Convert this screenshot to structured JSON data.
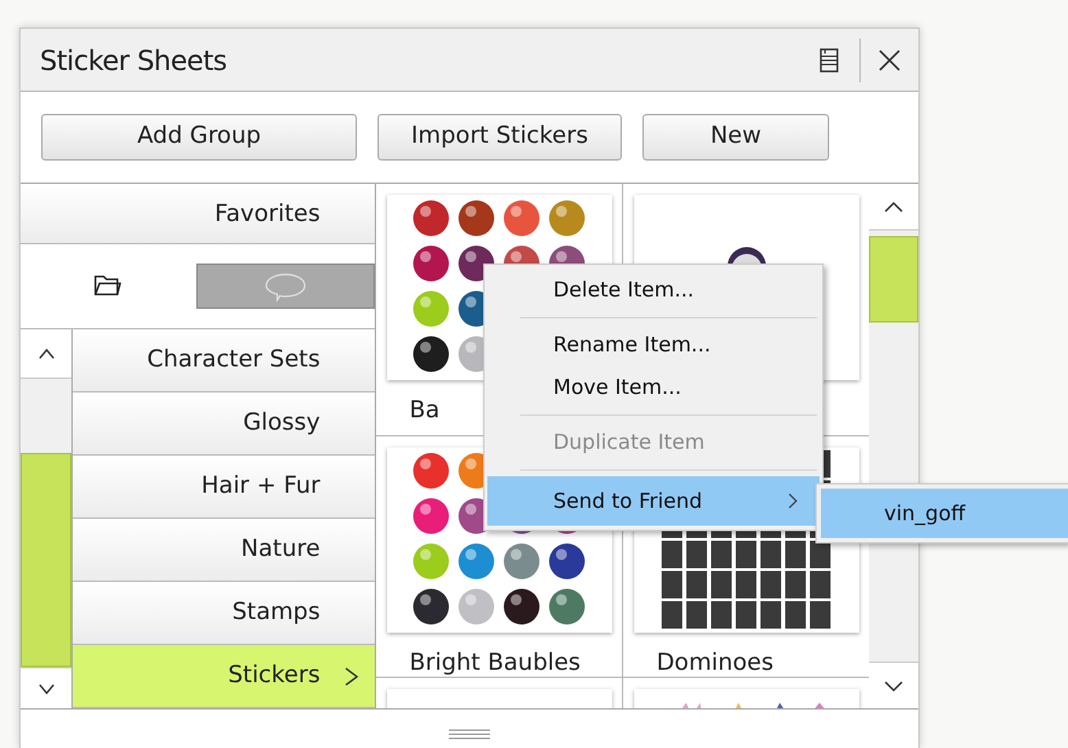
{
  "window": {
    "title": "Sticker Sheets"
  },
  "toolbar": {
    "buttons": [
      "Add Group",
      "Import Stickers",
      "New"
    ]
  },
  "sidebar": {
    "favorites": "Favorites",
    "tabs": [
      {
        "kind": "folder",
        "selected": true
      },
      {
        "kind": "chat",
        "selected": false
      }
    ],
    "groups": [
      {
        "label": "Character Sets",
        "selected": false
      },
      {
        "label": "Glossy",
        "selected": false
      },
      {
        "label": "Hair + Fur",
        "selected": false
      },
      {
        "label": "Nature",
        "selected": false
      },
      {
        "label": "Stamps",
        "selected": false
      },
      {
        "label": "Stickers",
        "selected": true
      }
    ]
  },
  "sheets": [
    {
      "kind": "baubles",
      "label": "Ba"
    },
    {
      "kind": "sphere"
    },
    {
      "kind": "baubles",
      "label": "Bright Baubles"
    },
    {
      "kind": "dominoes",
      "label": "Dominoes"
    },
    {
      "kind": "blank"
    },
    {
      "kind": "butterflies"
    }
  ],
  "context_menu": {
    "items": [
      {
        "kind": "item",
        "label": "Delete Item...",
        "disabled": false,
        "selected": false
      },
      {
        "kind": "separator"
      },
      {
        "kind": "item",
        "label": "Rename Item...",
        "disabled": false,
        "selected": false
      },
      {
        "kind": "item",
        "label": "Move Item...",
        "disabled": false,
        "selected": false
      },
      {
        "kind": "separator"
      },
      {
        "kind": "item",
        "label": "Duplicate Item",
        "disabled": true,
        "selected": false
      },
      {
        "kind": "separator"
      },
      {
        "kind": "submenu",
        "label": "Send to Friend",
        "disabled": false,
        "selected": true
      }
    ],
    "submenu": [
      {
        "label": "vin_goff",
        "selected": true
      }
    ]
  }
}
